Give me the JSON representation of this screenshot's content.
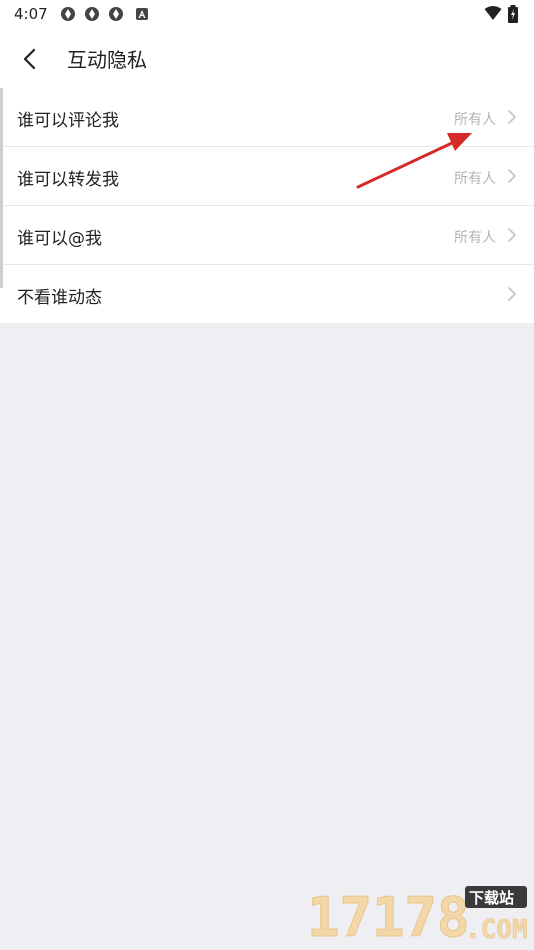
{
  "status": {
    "time": "4:07",
    "icons": [
      "app-icon",
      "app-icon",
      "app-icon",
      "a-icon"
    ],
    "right_icons": [
      "wifi-icon",
      "battery-icon"
    ]
  },
  "header": {
    "back_icon": "chevron-left-icon",
    "title": "互动隐私"
  },
  "settings": [
    {
      "label": "谁可以评论我",
      "value": "所有人"
    },
    {
      "label": "谁可以转发我",
      "value": "所有人"
    },
    {
      "label": "谁可以@我",
      "value": "所有人"
    },
    {
      "label": "不看谁动态",
      "value": ""
    }
  ],
  "watermark": {
    "number": "17178",
    "tag": "下载站",
    "domain": ".COM"
  },
  "colors": {
    "background": "#efeef3",
    "annotation_arrow": "#d62a2a",
    "secondary_text": "#b4b4b8"
  }
}
